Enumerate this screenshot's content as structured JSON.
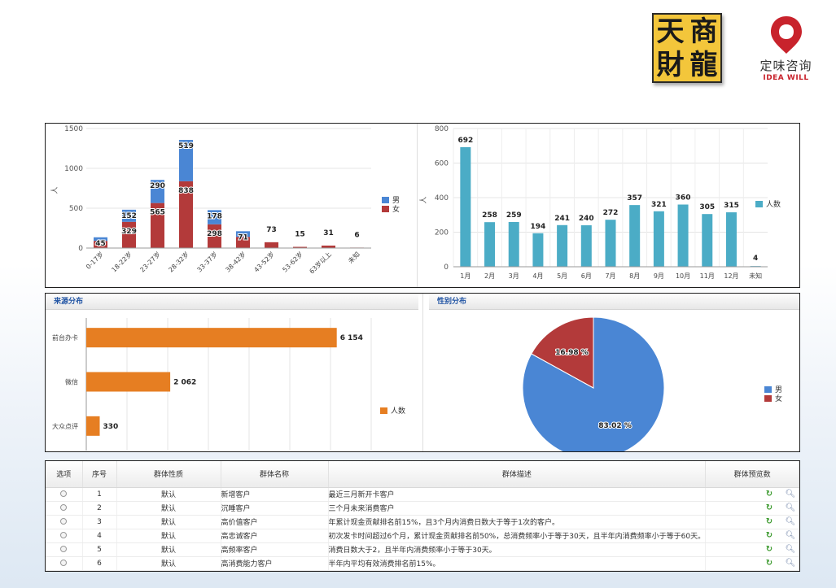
{
  "logos": {
    "tianshang_chars": [
      "天",
      "商",
      "財",
      "龍"
    ],
    "dingwei_cn": "定味咨询",
    "dingwei_en": "IDEA WILL",
    "dingwei_color": "#c8232c"
  },
  "chart_data": [
    {
      "type": "bar",
      "stacked": true,
      "categories": [
        "0-17岁",
        "18-22岁",
        "23-27岁",
        "28-32岁",
        "33-37岁",
        "38-42岁",
        "43-52岁",
        "53-62岁",
        "63岁以上",
        "未知"
      ],
      "series": [
        {
          "name": "男",
          "color": "#4a86d4",
          "values": [
            45,
            152,
            290,
            519,
            178,
            71,
            0,
            0,
            0,
            0
          ]
        },
        {
          "name": "女",
          "color": "#b33a3a",
          "values": [
            90,
            329,
            565,
            838,
            298,
            140,
            73,
            15,
            31,
            6
          ]
        }
      ],
      "totals_labels": [
        "45",
        "152",
        "290",
        "519",
        "178",
        "71",
        "73",
        "15",
        "31",
        "6"
      ],
      "inner_labels": [
        "",
        "329",
        "565",
        "838",
        "298",
        "",
        "",
        "",
        "",
        ""
      ],
      "ylabel": "人",
      "yticks": [
        "0",
        "500",
        "1000",
        "1500"
      ],
      "ylim": [
        0,
        1500
      ],
      "legend": "right"
    },
    {
      "type": "bar",
      "categories": [
        "1月",
        "2月",
        "3月",
        "4月",
        "5月",
        "6月",
        "7月",
        "8月",
        "9月",
        "10月",
        "11月",
        "12月",
        "未知"
      ],
      "series": [
        {
          "name": "人数",
          "color": "#4bacc6",
          "values": [
            692,
            258,
            259,
            194,
            241,
            240,
            272,
            357,
            321,
            360,
            305,
            315,
            4
          ]
        }
      ],
      "ylabel": "人",
      "yticks": [
        "0",
        "200",
        "400",
        "600",
        "800"
      ],
      "ylim": [
        0,
        800
      ],
      "legend": "right"
    },
    {
      "type": "bar",
      "orientation": "horizontal",
      "title": "来源分布",
      "categories": [
        "前台办卡",
        "微信",
        "大众点评"
      ],
      "series": [
        {
          "name": "人数",
          "color": "#e67e22",
          "values": [
            6154,
            2062,
            330
          ]
        }
      ],
      "value_labels": [
        "6 154",
        "2 062",
        "330"
      ],
      "xticks": [
        "0k",
        "1k",
        "2k",
        "3k",
        "4k",
        "5k",
        "6k",
        "7k"
      ],
      "xlim": [
        0,
        7000
      ],
      "legend": "right"
    },
    {
      "type": "pie",
      "title": "性别分布",
      "series": [
        {
          "name": "男",
          "color": "#4a86d4",
          "value": 83.02,
          "label": "83.02 %"
        },
        {
          "name": "女",
          "color": "#b33a3a",
          "value": 16.98,
          "label": "16.98 %"
        }
      ],
      "legend": "right"
    }
  ],
  "table": {
    "headers": [
      "选项",
      "序号",
      "群体性质",
      "群体名称",
      "群体描述",
      "群体预览数"
    ],
    "rows": [
      {
        "no": "1",
        "type": "默认",
        "name": "新增客户",
        "desc": "最近三月新开卡客户"
      },
      {
        "no": "2",
        "type": "默认",
        "name": "沉睡客户",
        "desc": "三个月未来消费客户"
      },
      {
        "no": "3",
        "type": "默认",
        "name": "高价值客户",
        "desc": "年累计现金贡献排名前15%，且3个月内消费日数大于等于1次的客户。"
      },
      {
        "no": "4",
        "type": "默认",
        "name": "高忠诚客户",
        "desc": "初次发卡时间超过6个月，累计现金贡献排名前50%，总消费频率小于等于30天，且半年内消费频率小于等于60天。"
      },
      {
        "no": "5",
        "type": "默认",
        "name": "高频率客户",
        "desc": "消费日数大于2，且半年内消费频率小于等于30天。"
      },
      {
        "no": "6",
        "type": "默认",
        "name": "高消费能力客户",
        "desc": "半年内平均有效消费排名前15%。"
      }
    ],
    "icons": {
      "refresh": "refresh-icon",
      "preview": "magnifier-icon"
    }
  }
}
